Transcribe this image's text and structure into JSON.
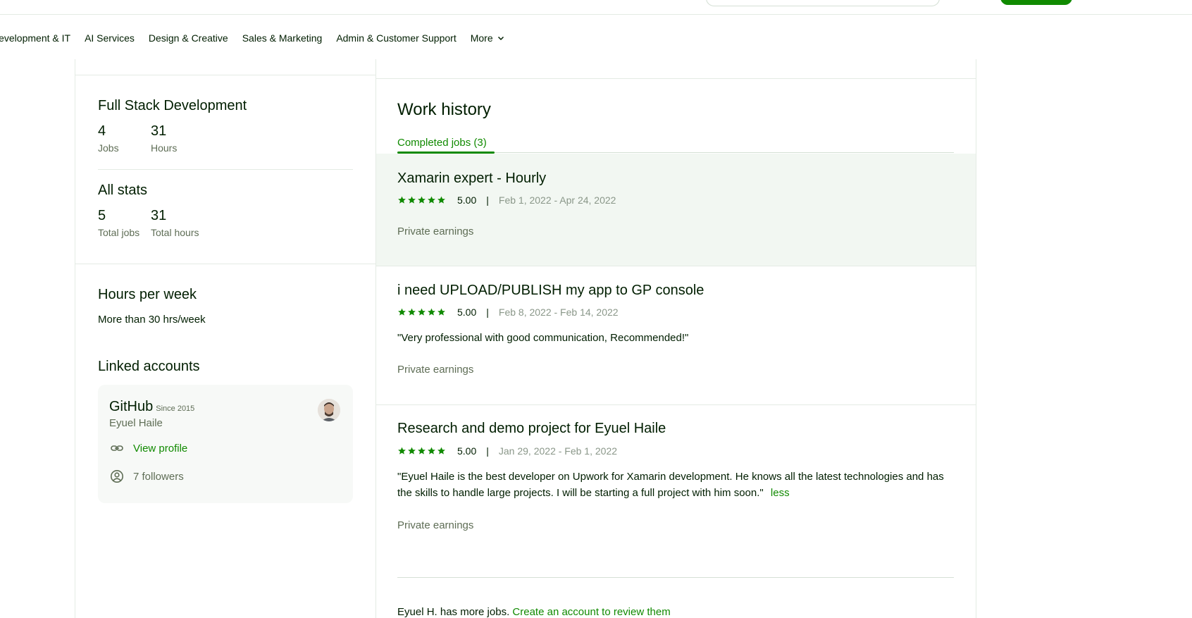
{
  "nav": {
    "categories": [
      "Development & IT",
      "AI Services",
      "Design & Creative",
      "Sales & Marketing",
      "Admin & Customer Support"
    ],
    "more_label": "More"
  },
  "sidebar": {
    "specialty": {
      "title": "Full Stack Development",
      "jobs_value": "4",
      "jobs_label": "Jobs",
      "hours_value": "31",
      "hours_label": "Hours"
    },
    "all_stats": {
      "title": "All stats",
      "total_jobs_value": "5",
      "total_jobs_label": "Total jobs",
      "total_hours_value": "31",
      "total_hours_label": "Total hours"
    },
    "hours_per_week": {
      "title": "Hours per week",
      "value": "More than 30 hrs/week"
    },
    "linked_accounts": {
      "title": "Linked accounts",
      "github": {
        "name": "GitHub",
        "since": "Since 2015",
        "user": "Eyuel Haile",
        "view_profile": "View profile",
        "followers": "7 followers"
      }
    }
  },
  "work_history": {
    "title": "Work history",
    "tab_label": "Completed jobs (3)",
    "jobs": [
      {
        "title": "Xamarin expert - Hourly",
        "rating": "5.00",
        "separator": "|",
        "dates": "Feb 1, 2022 - Apr 24, 2022",
        "review": "",
        "earnings": "Private earnings"
      },
      {
        "title": "i need UPLOAD/PUBLISH my app to GP console",
        "rating": "5.00",
        "separator": "|",
        "dates": "Feb 8, 2022 - Feb 14, 2022",
        "review": "\"Very professional with good communication, Recommended!\"",
        "earnings": "Private earnings"
      },
      {
        "title": "Research and demo project for Eyuel Haile",
        "rating": "5.00",
        "separator": "|",
        "dates": "Jan 29, 2022 - Feb 1, 2022",
        "review": "\"Eyuel Haile is the best developer on Upwork for Xamarin development. He knows all the latest technologies and has the skills to handle large projects. I will be starting a full project with him soon.\"",
        "review_toggle": "less",
        "earnings": "Private earnings"
      }
    ],
    "more_jobs_text": "Eyuel H. has more jobs.",
    "more_jobs_link": "Create an account to review them"
  },
  "colors": {
    "accent": "#108a00",
    "highlight_bg": "#f2f7f2",
    "text": "#001e00",
    "muted": "#5e6d55"
  }
}
